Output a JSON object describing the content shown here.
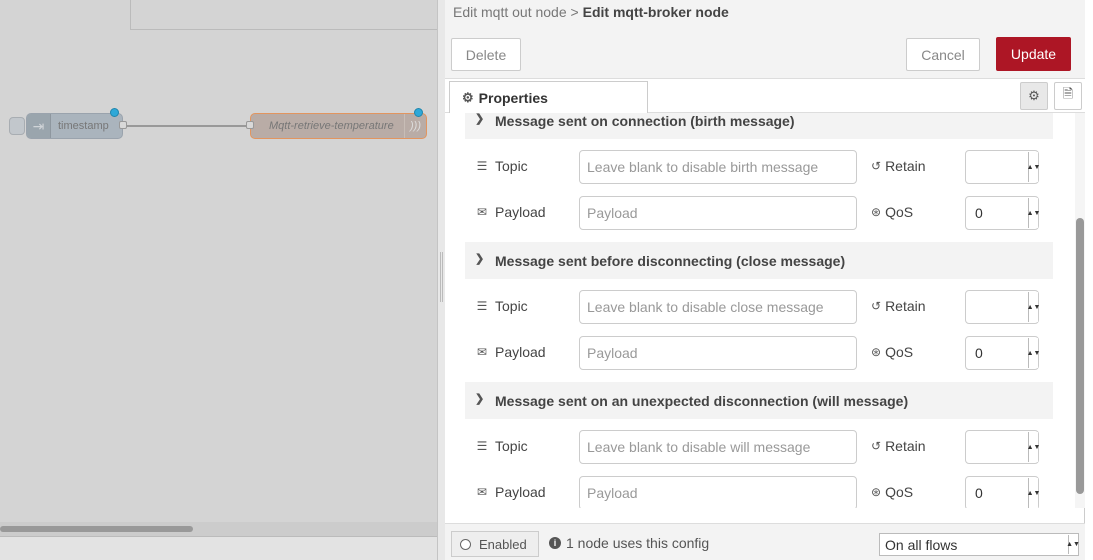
{
  "workspace": {
    "nodes": [
      {
        "label": "timestamp"
      },
      {
        "label": "Mqtt-retrieve-temperature"
      }
    ]
  },
  "tray": {
    "breadcrumb": {
      "parent": "Edit mqtt out node",
      "separator": ">",
      "current": "Edit mqtt-broker node"
    },
    "buttons": {
      "delete": "Delete",
      "cancel": "Cancel",
      "update": "Update"
    },
    "tabs": [
      {
        "label": "Properties",
        "active": true
      }
    ],
    "sections": [
      {
        "title": "Message sent on connection (birth message)",
        "topic_label": "Topic",
        "topic_placeholder": "Leave blank to disable birth message",
        "retain_label": "Retain",
        "retain_value": "",
        "payload_label": "Payload",
        "payload_placeholder": "Payload",
        "qos_label": "QoS",
        "qos_value": "0"
      },
      {
        "title": "Message sent before disconnecting (close message)",
        "topic_label": "Topic",
        "topic_placeholder": "Leave blank to disable close message",
        "retain_label": "Retain",
        "retain_value": "",
        "payload_label": "Payload",
        "payload_placeholder": "Payload",
        "qos_label": "QoS",
        "qos_value": "0"
      },
      {
        "title": "Message sent on an unexpected disconnection (will message)",
        "topic_label": "Topic",
        "topic_placeholder": "Leave blank to disable will message",
        "retain_label": "Retain",
        "retain_value": "",
        "payload_label": "Payload",
        "payload_placeholder": "Payload",
        "qos_label": "QoS",
        "qos_value": "0"
      }
    ],
    "footer": {
      "enabled_label": "Enabled",
      "usage_text": "1 node uses this config",
      "scope_value": "On all flows"
    }
  },
  "colors": {
    "accent": "#ad1625",
    "mqtt_node_border": "#e2955f",
    "status_dot": "#2ea8d8"
  },
  "icons": [
    "gear-icon",
    "info-doc-icon",
    "chevron-down-icon",
    "list-icon",
    "envelope-icon",
    "history-icon",
    "asterisk-icon",
    "info-circle-icon",
    "circle-icon",
    "arrows-icon",
    "wifi-icon"
  ]
}
